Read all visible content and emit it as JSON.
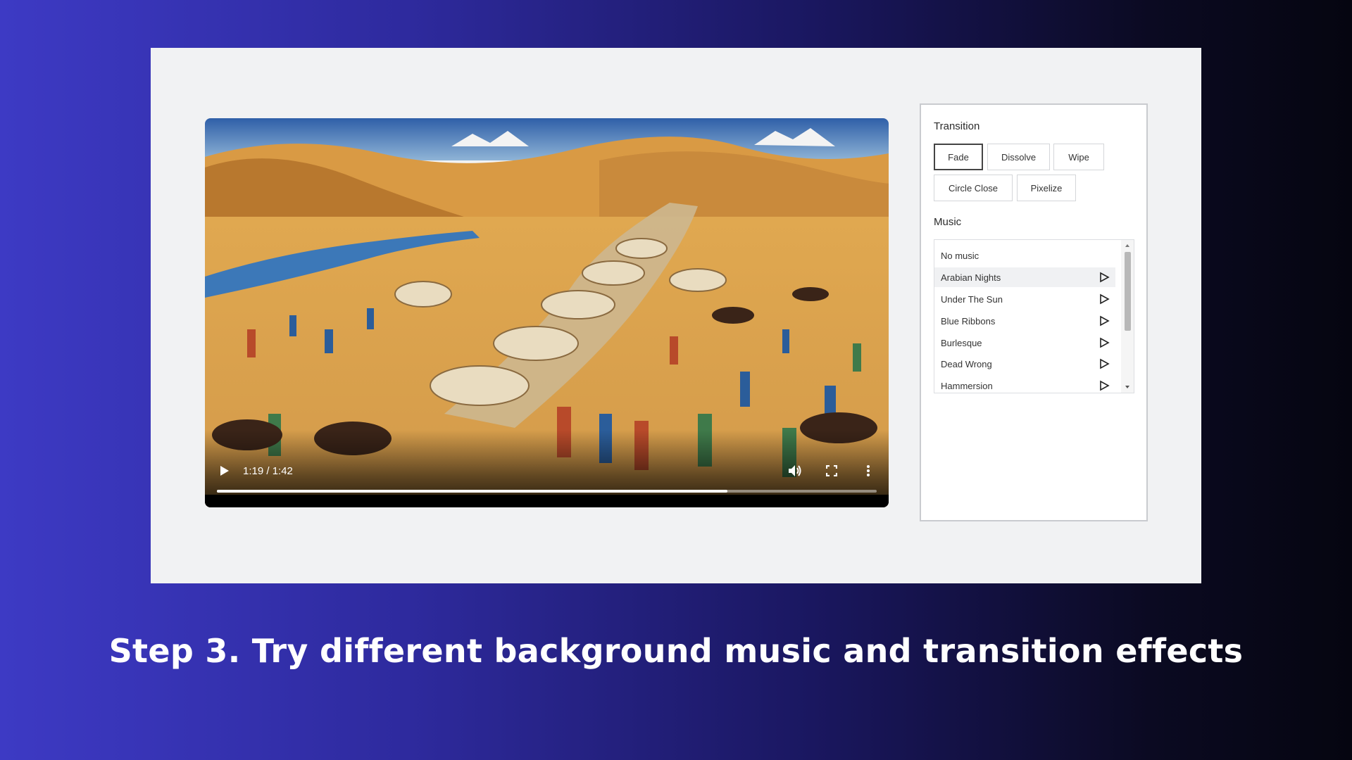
{
  "player": {
    "time_display": "1:19 / 1:42",
    "progress_fraction": 0.774
  },
  "transition": {
    "label": "Transition",
    "options": [
      "Fade",
      "Dissolve",
      "Wipe",
      "Circle Close",
      "Pixelize"
    ],
    "selected": "Fade"
  },
  "music": {
    "label": "Music",
    "tracks": [
      "No music",
      "Arabian Nights",
      "Under The Sun",
      "Blue Ribbons",
      "Burlesque",
      "Dead Wrong",
      "Hammersion"
    ],
    "highlighted": "Arabian Nights"
  },
  "caption": "Step 3. Try different background music and transition effects"
}
